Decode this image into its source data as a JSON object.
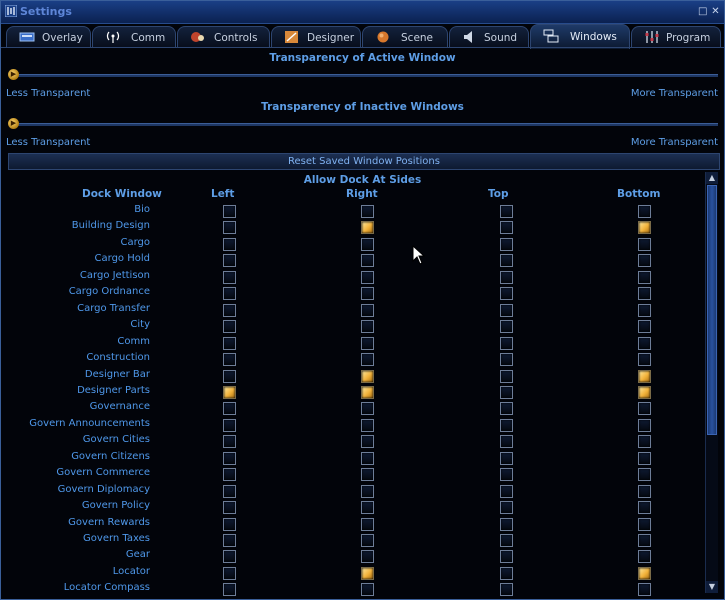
{
  "window": {
    "title": "Settings"
  },
  "tabs": [
    {
      "label": "Overlay",
      "icon": "overlay-icon",
      "active": false
    },
    {
      "label": "Comm",
      "icon": "antenna-icon",
      "active": false
    },
    {
      "label": "Controls",
      "icon": "controls-icon",
      "active": false
    },
    {
      "label": "Designer",
      "icon": "designer-icon",
      "active": false
    },
    {
      "label": "Scene",
      "icon": "planet-icon",
      "active": false
    },
    {
      "label": "Sound",
      "icon": "speaker-icon",
      "active": false
    },
    {
      "label": "Windows",
      "icon": "windows-icon",
      "active": true
    },
    {
      "label": "Program",
      "icon": "program-icon",
      "active": false
    }
  ],
  "active_transparency": {
    "title": "Transparency of Active Window",
    "left_label": "Less Transparent",
    "right_label": "More Transparent",
    "value": 0
  },
  "inactive_transparency": {
    "title": "Transparency of Inactive Windows",
    "left_label": "Less Transparent",
    "right_label": "More Transparent",
    "value": 0
  },
  "reset_button": "Reset Saved Window Positions",
  "dock": {
    "heading": "Allow Dock At Sides",
    "columns": [
      "Dock Window",
      "Left",
      "Right",
      "Top",
      "Bottom"
    ],
    "rows": [
      {
        "name": "Bio",
        "left": false,
        "right": false,
        "top": false,
        "bottom": false
      },
      {
        "name": "Building Design",
        "left": false,
        "right": true,
        "top": false,
        "bottom": true
      },
      {
        "name": "Cargo",
        "left": false,
        "right": false,
        "top": false,
        "bottom": false
      },
      {
        "name": "Cargo Hold",
        "left": false,
        "right": false,
        "top": false,
        "bottom": false
      },
      {
        "name": "Cargo Jettison",
        "left": false,
        "right": false,
        "top": false,
        "bottom": false
      },
      {
        "name": "Cargo Ordnance",
        "left": false,
        "right": false,
        "top": false,
        "bottom": false
      },
      {
        "name": "Cargo Transfer",
        "left": false,
        "right": false,
        "top": false,
        "bottom": false
      },
      {
        "name": "City",
        "left": false,
        "right": false,
        "top": false,
        "bottom": false
      },
      {
        "name": "Comm",
        "left": false,
        "right": false,
        "top": false,
        "bottom": false
      },
      {
        "name": "Construction",
        "left": false,
        "right": false,
        "top": false,
        "bottom": false
      },
      {
        "name": "Designer Bar",
        "left": false,
        "right": true,
        "top": false,
        "bottom": true
      },
      {
        "name": "Designer Parts",
        "left": true,
        "right": true,
        "top": false,
        "bottom": true
      },
      {
        "name": "Governance",
        "left": false,
        "right": false,
        "top": false,
        "bottom": false
      },
      {
        "name": "Govern Announcements",
        "left": false,
        "right": false,
        "top": false,
        "bottom": false
      },
      {
        "name": "Govern Cities",
        "left": false,
        "right": false,
        "top": false,
        "bottom": false
      },
      {
        "name": "Govern Citizens",
        "left": false,
        "right": false,
        "top": false,
        "bottom": false
      },
      {
        "name": "Govern Commerce",
        "left": false,
        "right": false,
        "top": false,
        "bottom": false
      },
      {
        "name": "Govern Diplomacy",
        "left": false,
        "right": false,
        "top": false,
        "bottom": false
      },
      {
        "name": "Govern Policy",
        "left": false,
        "right": false,
        "top": false,
        "bottom": false
      },
      {
        "name": "Govern Rewards",
        "left": false,
        "right": false,
        "top": false,
        "bottom": false
      },
      {
        "name": "Govern Taxes",
        "left": false,
        "right": false,
        "top": false,
        "bottom": false
      },
      {
        "name": "Gear",
        "left": false,
        "right": false,
        "top": false,
        "bottom": false
      },
      {
        "name": "Locator",
        "left": false,
        "right": true,
        "top": false,
        "bottom": true
      },
      {
        "name": "Locator Compass",
        "left": false,
        "right": false,
        "top": false,
        "bottom": false
      }
    ]
  },
  "colors": {
    "text": "#5e9ee6",
    "checked": "#f2b23a",
    "titlebar": "#1a3f86"
  }
}
